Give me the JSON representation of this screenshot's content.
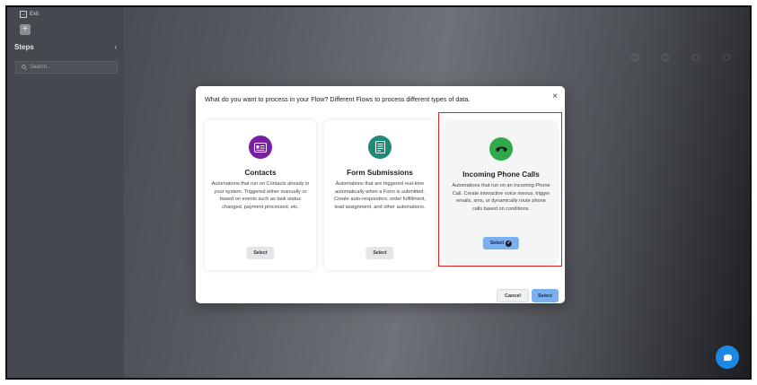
{
  "sidebar": {
    "exit_label": "Exit",
    "steps_title": "Steps",
    "collapse_glyph": "‹",
    "search_placeholder": "Search...",
    "add_glyph": "+"
  },
  "modal": {
    "title": "What do you want to process in your Flow? Different Flows to process different types of data.",
    "close_glyph": "×",
    "cards": [
      {
        "title": "Contacts",
        "description": "Automations that run on Contacts already in your system. Triggered either manually or based on events such as task status changed, payment processed, etc.",
        "button": "Select",
        "icon": "contact-card-icon",
        "icon_color": "#7b1fa2"
      },
      {
        "title": "Form Submissions",
        "description": "Automations that are triggered real-time automatically when a Form is submitted. Create auto-responders, order fulfillment, lead assignment, and other automations.",
        "button": "Select",
        "icon": "form-document-icon",
        "icon_color": "#1f8a78"
      },
      {
        "title": "Incoming Phone Calls",
        "description": "Automations that run on an Incoming Phone Call. Create interactive voice menus, trigger emails, sms, or dynamically route phone calls based on conditions.",
        "button": "Select",
        "icon": "phone-icon",
        "icon_color": "#2eaa4a",
        "selected": true
      }
    ],
    "cancel_label": "Cancel",
    "select_label": "Select"
  },
  "colors": {
    "accent": "#7bb0ee",
    "highlight": "#e02020",
    "chat_button": "#1e88e5"
  }
}
